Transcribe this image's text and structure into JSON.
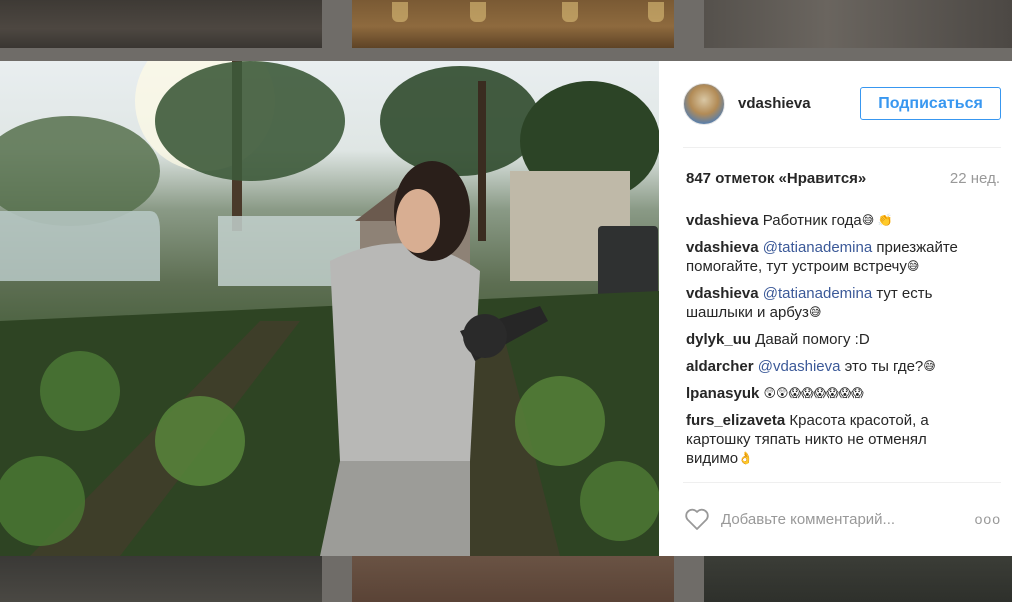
{
  "post": {
    "username": "vdashieva",
    "follow_label": "Подписаться",
    "likes_text": "847 отметок «Нравится»",
    "time_ago": "22 нед.",
    "comments": [
      {
        "user": "vdashieva",
        "parts": [
          {
            "t": "Работник года"
          }
        ],
        "emoji": "😅 👏"
      },
      {
        "user": "vdashieva",
        "mention": "@tatianademina",
        "parts": [
          {
            "t": " приезжайте помогайте, тут устроим встречу"
          }
        ],
        "emoji": "😅"
      },
      {
        "user": "vdashieva",
        "mention": "@tatianademina",
        "parts": [
          {
            "t": " тут есть шашлыки и арбуз"
          }
        ],
        "emoji": "😅"
      },
      {
        "user": "dylyk_uu",
        "parts": [
          {
            "t": "Давай помогу :D"
          }
        ],
        "emoji": ""
      },
      {
        "user": "aldarcher",
        "mention": "@vdashieva",
        "parts": [
          {
            "t": " это ты где?"
          }
        ],
        "emoji": "😅"
      },
      {
        "user": "lpanasyuk",
        "parts": [
          {
            "t": ""
          }
        ],
        "emoji": "😲😲😱😱😱😱😱😱"
      },
      {
        "user": "furs_elizaveta",
        "parts": [
          {
            "t": "Красота красотой, а картошку тяпать никто не отменял видимо"
          }
        ],
        "emoji": "👌"
      }
    ],
    "add_comment_placeholder": "Добавьте комментарий...",
    "more_label": "ooo"
  },
  "icons": {
    "heart": "heart-icon",
    "more": "more-options-icon"
  },
  "colors": {
    "accent": "#3897f0",
    "mention": "#3b5998",
    "text": "#262626",
    "muted": "#999999"
  }
}
